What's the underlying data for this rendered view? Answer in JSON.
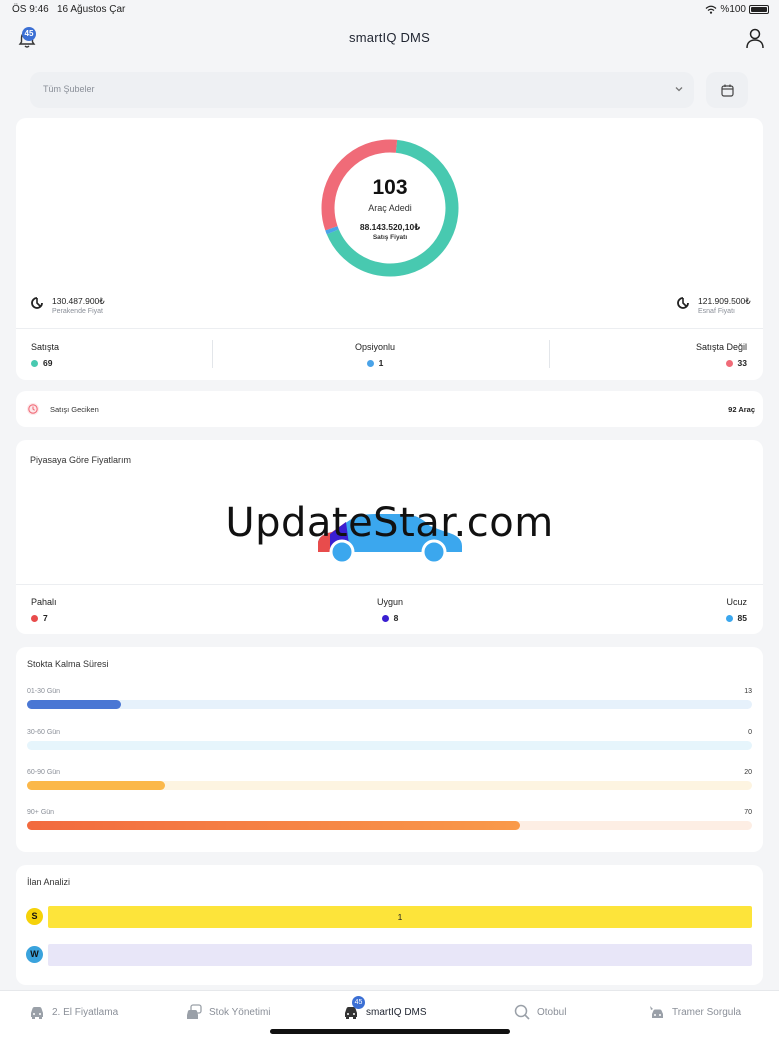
{
  "status_bar": {
    "time": "ÖS 9:46",
    "date": "16 Ağustos Çar",
    "battery": "%100"
  },
  "header": {
    "title": "smartIQ DMS",
    "notification_count": "45"
  },
  "filter": {
    "placeholder": "Tüm Şubeler"
  },
  "summary": {
    "count": "103",
    "count_label": "Araç Adedi",
    "sales_price": "88.143.520,10₺",
    "sales_price_label": "Satış Fiyatı",
    "donut": {
      "green_fraction": 0.67,
      "blue_fraction": 0.01,
      "red_fraction": 0.32,
      "colors": {
        "green": "#48c9b0",
        "blue": "#4aa3e8",
        "red": "#f06b78"
      }
    },
    "retail_price": "130.487.900₺",
    "retail_label": "Perakende Fiyat",
    "dealer_price": "121.909.500₺",
    "dealer_label": "Esnaf Fiyatı",
    "stats": [
      {
        "label": "Satışta",
        "value": "69",
        "color": "#48c9b0"
      },
      {
        "label": "Opsiyonlu",
        "value": "1",
        "color": "#4aa3e8"
      },
      {
        "label": "Satışta Değil",
        "value": "33",
        "color": "#f06b78"
      }
    ]
  },
  "delayed": {
    "label": "Satışı Geciken",
    "value": "92 Araç"
  },
  "market": {
    "title": "Piyasaya Göre Fiyatlarım",
    "watermark": "UpdateStar.com",
    "stats": [
      {
        "label": "Pahalı",
        "value": "7",
        "color": "#e84c4c"
      },
      {
        "label": "Uygun",
        "value": "8",
        "color": "#3a1fd1"
      },
      {
        "label": "Ucuz",
        "value": "85",
        "color": "#3ba7ee"
      }
    ]
  },
  "stock": {
    "title": "Stokta Kalma Süresi",
    "rows": [
      {
        "label": "01-30 Gün",
        "count": "13",
        "fraction": 0.13,
        "fill": "#4a77d4",
        "track": "#e6f1fb"
      },
      {
        "label": "30-60 Gün",
        "count": "0",
        "fraction": 0,
        "fill": "#5db5e8",
        "track": "#e6f5fc"
      },
      {
        "label": "60-90 Gün",
        "count": "20",
        "fraction": 0.19,
        "fill": "#fbb84a",
        "track": "#fdf4e1"
      },
      {
        "label": "90+ Gün",
        "count": "70",
        "fraction": 0.68,
        "fill": "#f4763f",
        "track": "#fdeee4"
      }
    ]
  },
  "ads": {
    "title": "İlan Analizi",
    "rows": [
      {
        "badge": "S",
        "value": "1",
        "badge_color": "#f5d20a",
        "bar_color": "#fde43a"
      },
      {
        "badge": "W",
        "value": "",
        "badge_color": "#3aa3dd",
        "bar_color": "#e8e6f8"
      }
    ]
  },
  "tabs": [
    {
      "label": "2. El Fiyatlama",
      "icon": "car-icon"
    },
    {
      "label": "Stok Yönetimi",
      "icon": "stock-cars-icon"
    },
    {
      "label": "smartIQ DMS",
      "icon": "dms-car-icon",
      "badge": "45",
      "active": true
    },
    {
      "label": "Otobul",
      "icon": "search-icon"
    },
    {
      "label": "Tramer Sorgula",
      "icon": "crash-car-icon"
    }
  ]
}
